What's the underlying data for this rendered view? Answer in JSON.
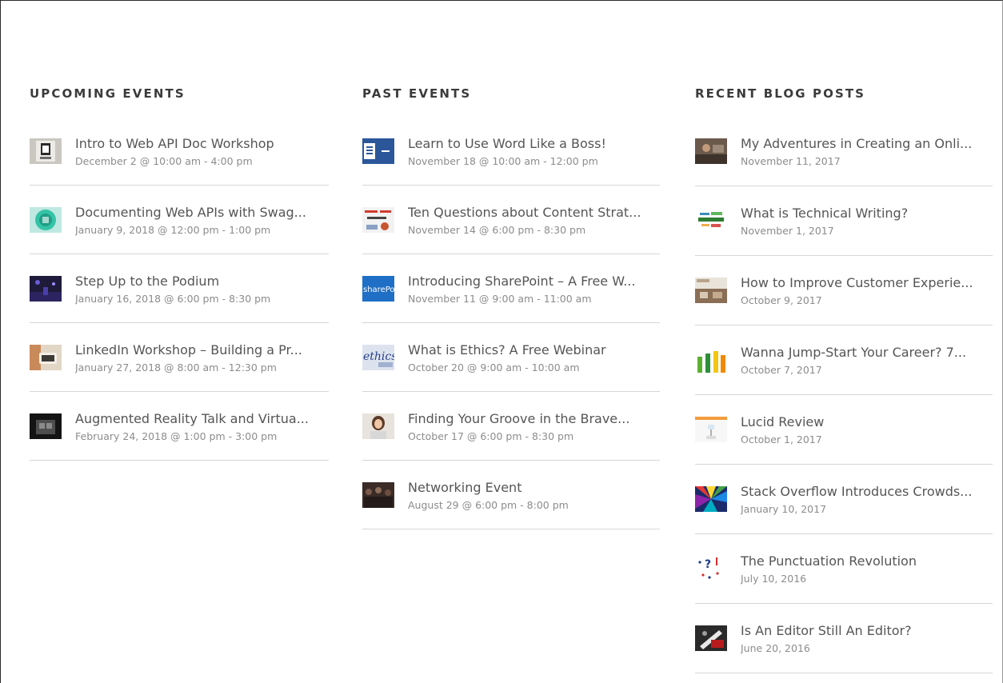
{
  "upcoming": {
    "heading": "UPCOMING EVENTS",
    "items": [
      {
        "title": "Intro to Web API Doc Workshop",
        "date": "December 2 @ 10:00 am - 4:00 pm",
        "thumb": "poster-thumbnail"
      },
      {
        "title": "Documenting Web APIs with Swag...",
        "date": "January 9, 2018 @ 12:00 pm - 1:00 pm",
        "thumb": "api-logo-thumbnail"
      },
      {
        "title": "Step Up to the Podium",
        "date": "January 16, 2018 @ 6:00 pm - 8:30 pm",
        "thumb": "stage-thumbnail"
      },
      {
        "title": "LinkedIn Workshop – Building a Pr...",
        "date": "January 27, 2018 @ 8:00 am - 12:30 pm",
        "thumb": "linkedin-thumbnail"
      },
      {
        "title": "Augmented Reality Talk and Virtua...",
        "date": "February 24, 2018 @ 1:00 pm - 3:00 pm",
        "thumb": "vr-headset-thumbnail"
      }
    ]
  },
  "past": {
    "heading": "PAST EVENTS",
    "items": [
      {
        "title": "Learn to Use Word Like a Boss!",
        "date": "November 18 @ 10:00 am - 12:00 pm",
        "thumb": "word-logo-thumbnail"
      },
      {
        "title": "Ten Questions about Content Strat...",
        "date": "November 14 @ 6:00 pm - 8:30 pm",
        "thumb": "content-strategy-thumbnail"
      },
      {
        "title": "Introducing SharePoint – A Free W...",
        "date": "November 11 @ 9:00 am - 11:00 am",
        "thumb": "sharepoint-thumbnail",
        "thumb_text": "sharePo"
      },
      {
        "title": "What is Ethics? A Free Webinar",
        "date": "October 20 @ 9:00 am - 10:00 am",
        "thumb": "ethics-thumbnail",
        "thumb_text": "ethics"
      },
      {
        "title": "Finding Your Groove in the Brave...",
        "date": "October 17 @ 6:00 pm - 8:30 pm",
        "thumb": "portrait-thumbnail"
      },
      {
        "title": "Networking Event",
        "date": "August 29 @ 6:00 pm - 8:00 pm",
        "thumb": "crowd-thumbnail"
      }
    ]
  },
  "blog": {
    "heading": "RECENT BLOG POSTS",
    "items": [
      {
        "title": "My Adventures in Creating an Onli...",
        "date": "November 11, 2017",
        "thumb": "desk-photo-thumbnail"
      },
      {
        "title": "What is Technical Writing?",
        "date": "November 1, 2017",
        "thumb": "word-cloud-thumbnail"
      },
      {
        "title": "How to Improve Customer Experie...",
        "date": "October 9, 2017",
        "thumb": "store-thumbnail"
      },
      {
        "title": "Wanna Jump-Start Your Career? 7...",
        "date": "October 7, 2017",
        "thumb": "hands-thumbnail"
      },
      {
        "title": "Lucid Review",
        "date": "October 1, 2017",
        "thumb": "diagram-thumbnail"
      },
      {
        "title": "Stack Overflow Introduces Crowds...",
        "date": "January 10, 2017",
        "thumb": "colorful-rays-thumbnail"
      },
      {
        "title": "The Punctuation Revolution",
        "date": "July 10, 2016",
        "thumb": "punctuation-thumbnail",
        "thumb_text": "?"
      },
      {
        "title": "Is An Editor Still An Editor?",
        "date": "June 20, 2016",
        "thumb": "editor-photo-thumbnail"
      }
    ]
  }
}
